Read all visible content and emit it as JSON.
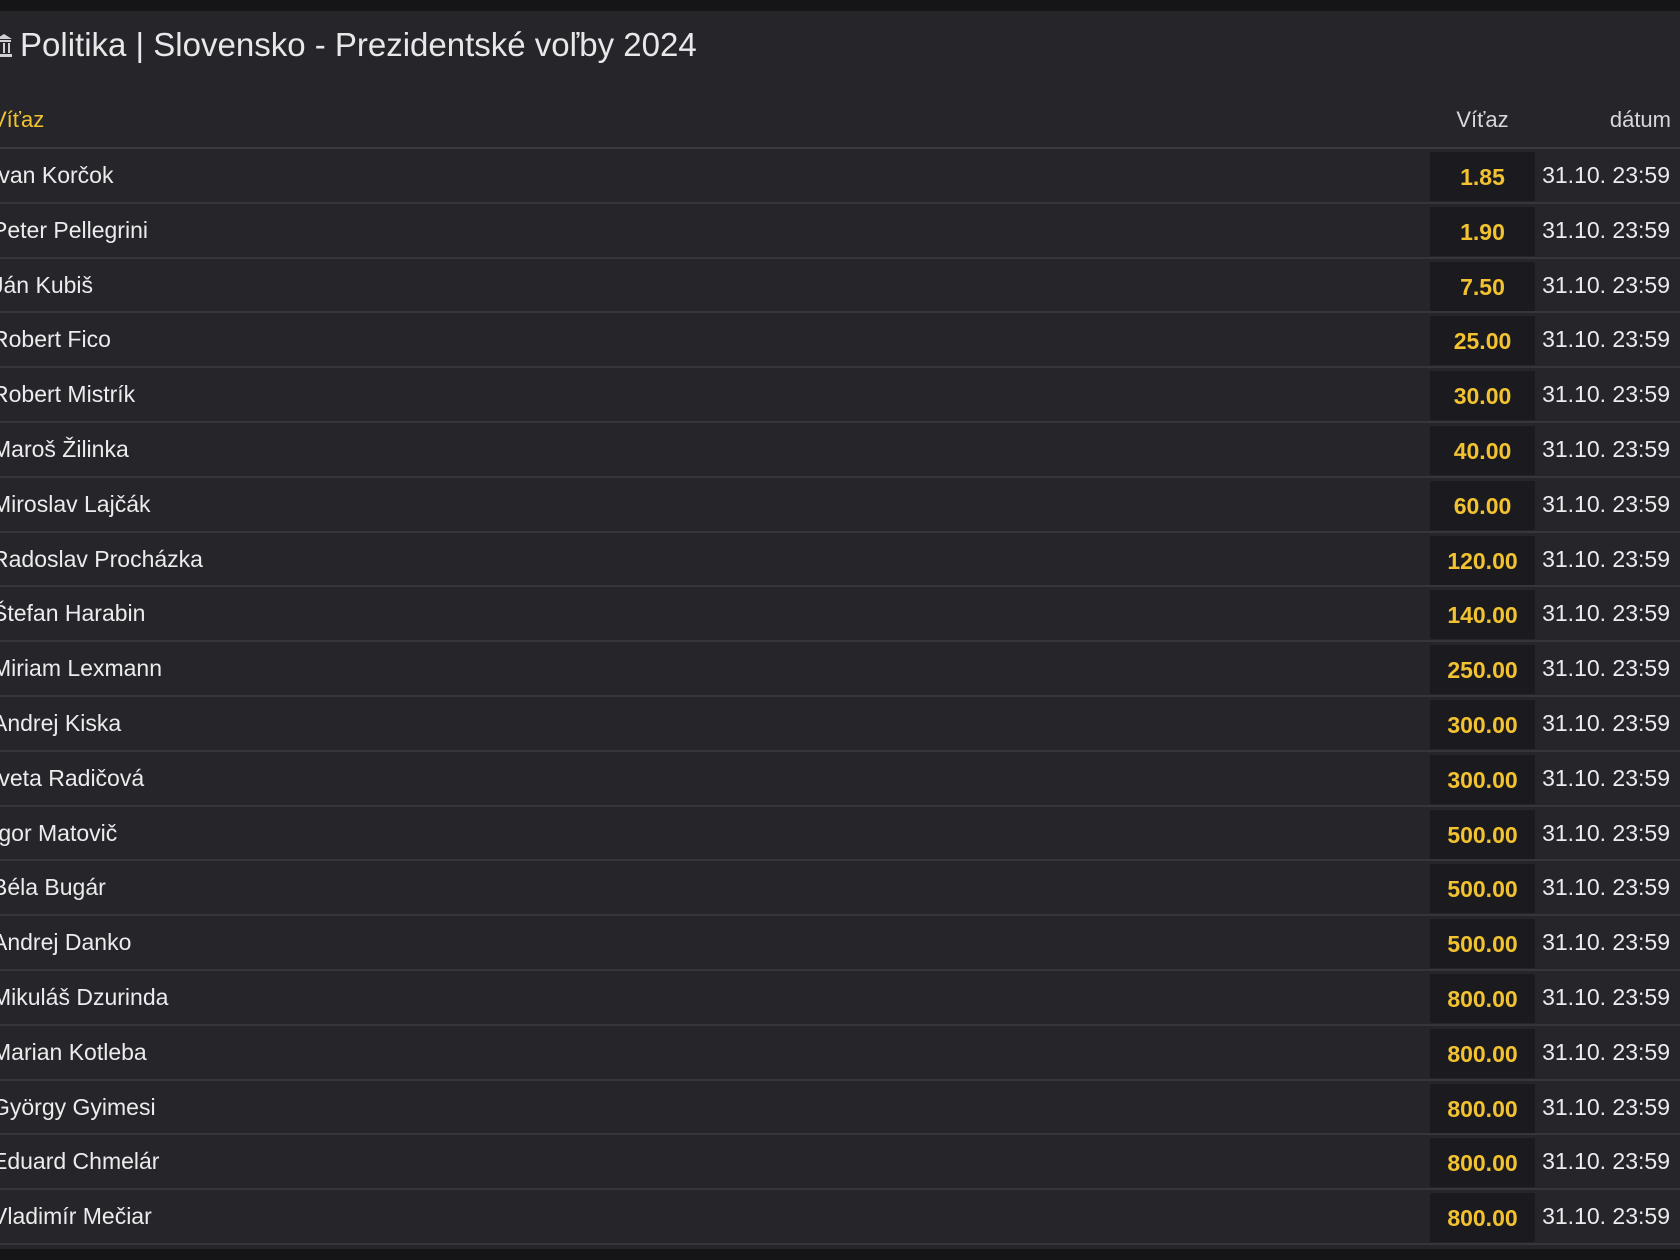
{
  "title": "Politika | Slovensko - Prezidentské voľby 2024",
  "title_icon": "institution-icon",
  "colors": {
    "accent": "#f2c230",
    "background": "#25252a",
    "odds_cell": "#1b1b1f"
  },
  "table": {
    "headers": {
      "market": "Víťaz",
      "odds": "Víťaz",
      "date": "dátum"
    },
    "rows": [
      {
        "name": "Ivan Korčok",
        "odds": "1.85",
        "date": "31.10. 23:59"
      },
      {
        "name": "Peter Pellegrini",
        "odds": "1.90",
        "date": "31.10. 23:59"
      },
      {
        "name": "Ján Kubiš",
        "odds": "7.50",
        "date": "31.10. 23:59"
      },
      {
        "name": "Robert Fico",
        "odds": "25.00",
        "date": "31.10. 23:59"
      },
      {
        "name": "Robert Mistrík",
        "odds": "30.00",
        "date": "31.10. 23:59"
      },
      {
        "name": "Maroš Žilinka",
        "odds": "40.00",
        "date": "31.10. 23:59"
      },
      {
        "name": "Miroslav Lajčák",
        "odds": "60.00",
        "date": "31.10. 23:59"
      },
      {
        "name": "Radoslav Procházka",
        "odds": "120.00",
        "date": "31.10. 23:59"
      },
      {
        "name": "Štefan Harabin",
        "odds": "140.00",
        "date": "31.10. 23:59"
      },
      {
        "name": "Miriam Lexmann",
        "odds": "250.00",
        "date": "31.10. 23:59"
      },
      {
        "name": "Andrej Kiska",
        "odds": "300.00",
        "date": "31.10. 23:59"
      },
      {
        "name": "Iveta Radičová",
        "odds": "300.00",
        "date": "31.10. 23:59"
      },
      {
        "name": "Igor Matovič",
        "odds": "500.00",
        "date": "31.10. 23:59"
      },
      {
        "name": "Béla Bugár",
        "odds": "500.00",
        "date": "31.10. 23:59"
      },
      {
        "name": "Andrej Danko",
        "odds": "500.00",
        "date": "31.10. 23:59"
      },
      {
        "name": "Mikuláš Dzurinda",
        "odds": "800.00",
        "date": "31.10. 23:59"
      },
      {
        "name": "Marian Kotleba",
        "odds": "800.00",
        "date": "31.10. 23:59"
      },
      {
        "name": "György Gyimesi",
        "odds": "800.00",
        "date": "31.10. 23:59"
      },
      {
        "name": "Eduard Chmelár",
        "odds": "800.00",
        "date": "31.10. 23:59"
      },
      {
        "name": "Vladimír Mečiar",
        "odds": "800.00",
        "date": "31.10. 23:59"
      }
    ]
  }
}
